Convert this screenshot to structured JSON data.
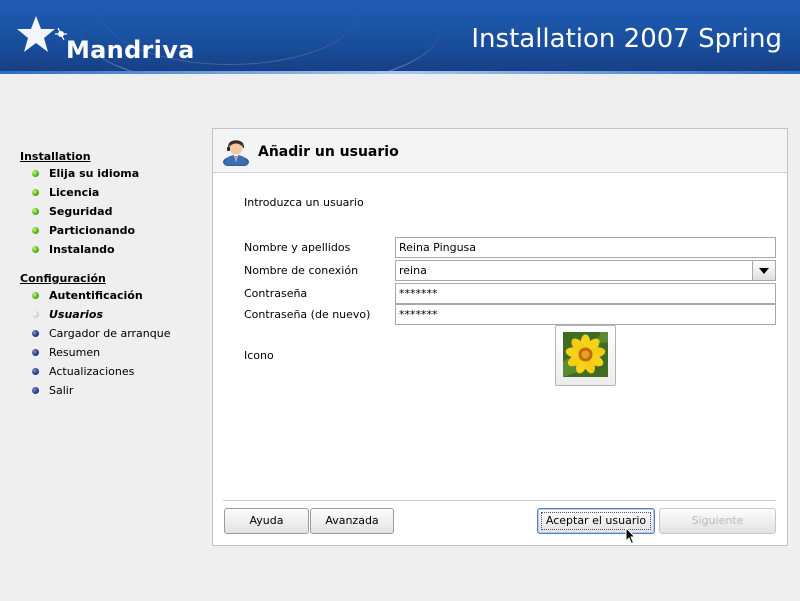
{
  "header": {
    "brand": "Mandriva",
    "title": "Installation 2007 Spring",
    "colors": {
      "banner": "#1a4f9e",
      "text": "#ffffff"
    }
  },
  "sidebar": {
    "sections": [
      {
        "title": "Installation",
        "steps": [
          {
            "label": "Elija su idioma",
            "state": "done"
          },
          {
            "label": "Licencia",
            "state": "done"
          },
          {
            "label": "Seguridad",
            "state": "done"
          },
          {
            "label": "Particionando",
            "state": "done"
          },
          {
            "label": "Instalando",
            "state": "done"
          }
        ]
      },
      {
        "title": "Configuración",
        "steps": [
          {
            "label": "Autentificación",
            "state": "done"
          },
          {
            "label": "Usuarios",
            "state": "current"
          },
          {
            "label": "Cargador de arranque",
            "state": "todo"
          },
          {
            "label": "Resumen",
            "state": "todo"
          },
          {
            "label": "Actualizaciones",
            "state": "todo"
          },
          {
            "label": "Salir",
            "state": "todo"
          }
        ]
      }
    ],
    "dot_colors": {
      "done": "#3fa10a",
      "current": "#d8d8e8",
      "todo": "#1c2a6e"
    }
  },
  "panel": {
    "title": "Añadir un usuario",
    "icon": "user-icon",
    "intro": "Introduzca un usuario",
    "fields": {
      "fullname": {
        "label": "Nombre y apellidos",
        "value": "Reina Pingusa"
      },
      "login": {
        "label": "Nombre de conexión",
        "value": "reina"
      },
      "password": {
        "label": "Contraseña",
        "value": "*******"
      },
      "password2": {
        "label": "Contraseña (de nuevo)",
        "value": "*******"
      },
      "icon": {
        "label": "Icono",
        "image": "flower-icon"
      }
    },
    "buttons": {
      "help": "Ayuda",
      "advanced": "Avanzada",
      "accept": "Aceptar el usuario",
      "next": "Siguiente"
    }
  }
}
